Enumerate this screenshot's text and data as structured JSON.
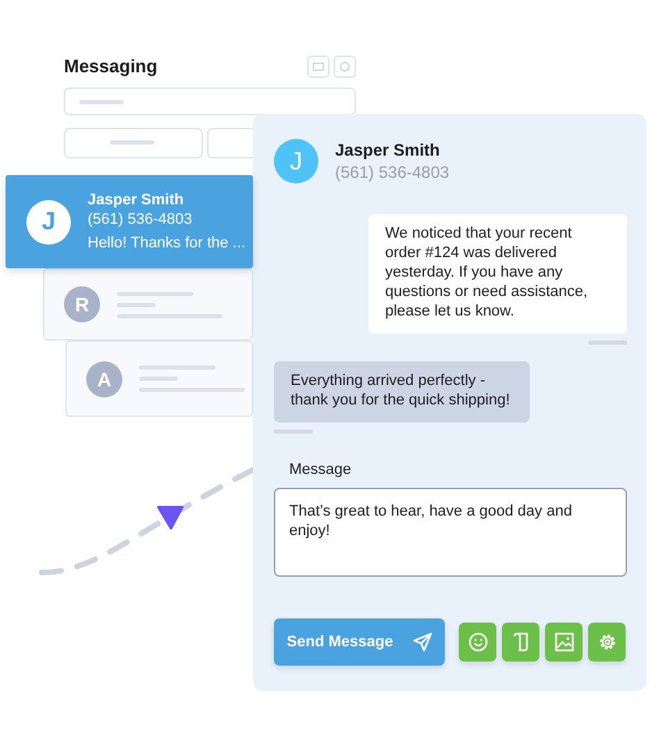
{
  "back_panel": {
    "title": "Messaging"
  },
  "contacts": [
    {
      "initial": "J",
      "name": "Jasper Smith",
      "phone": "(561) 536-4803",
      "preview": "Hello! Thanks for the ...",
      "selected": true
    },
    {
      "initial": "R",
      "selected": false
    },
    {
      "initial": "A",
      "selected": false
    }
  ],
  "chat": {
    "contact": {
      "initial": "J",
      "name": "Jasper Smith",
      "phone": "(561) 536-4803"
    },
    "messages": [
      {
        "kind": "outgoing",
        "text": "We noticed that your recent order #124 was delivered yesterday. If you have any questions or need assistance, please let us know."
      },
      {
        "kind": "incoming",
        "text": "Everything arrived perfectly - thank you for the quick shipping!"
      }
    ],
    "composer": {
      "label": "Message",
      "value": "That’s great to hear, have a good day and enjoy!"
    },
    "send_button": {
      "label": "Send Message"
    }
  }
}
